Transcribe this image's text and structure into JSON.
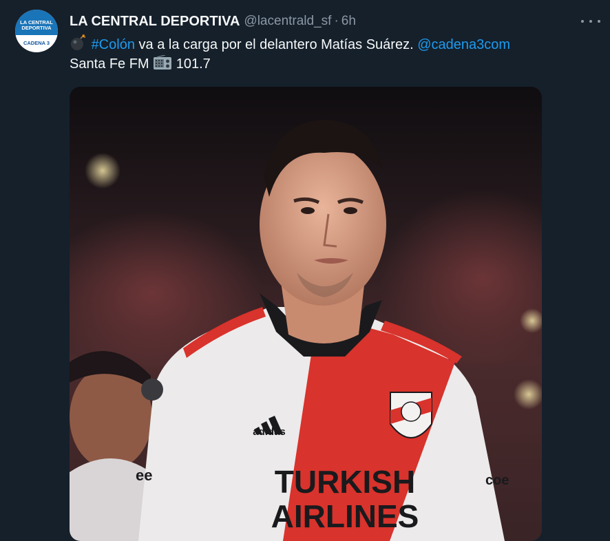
{
  "tweet": {
    "avatar": {
      "line1": "LA CENTRAL",
      "line2": "DEPORTIVA",
      "line3": "CADENA 3"
    },
    "author_name": "LA CENTRAL DEPORTIVA",
    "handle": "@lacentrald_sf",
    "separator": "·",
    "time": "6h",
    "hashtag": "#Colón",
    "text_main": " va a la carga por el delantero Matías Suárez. ",
    "mention": "@cadena3com",
    "text_line2_a": "Santa Fe FM ",
    "text_line2_b": " 101.7",
    "icons": [
      "bomb-emoji",
      "radio-emoji",
      "more-icon"
    ],
    "media": {
      "jersey_brand": "adidas",
      "jersey_sponsor_line1": "TURKISH",
      "jersey_sponsor_line2": "AIRLINES",
      "sleeve_text_left": "ee",
      "sleeve_text_right": "coe"
    }
  }
}
